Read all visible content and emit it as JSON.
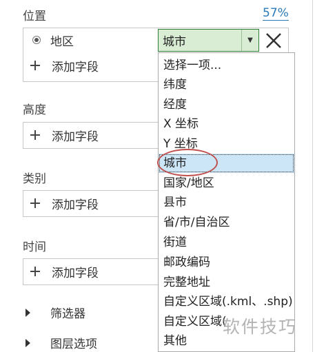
{
  "location": {
    "title": "位置",
    "percent": "57%",
    "field_label": "地区",
    "add_field": "添加字段",
    "combo_value": "城市"
  },
  "dropdown": {
    "options": [
      "选择一项...",
      "纬度",
      "经度",
      "X 坐标",
      "Y 坐标",
      "城市",
      "国家/地区",
      "县市",
      "省/市/自治区",
      "街道",
      "邮政编码",
      "完整地址",
      "自定义区域(.kml、.shp)",
      "自定义区域(",
      "其他"
    ],
    "selected_index": 5
  },
  "height": {
    "title": "高度",
    "add_field": "添加字段"
  },
  "category": {
    "title": "类别",
    "add_field": "添加字段"
  },
  "time": {
    "title": "时间",
    "add_field": "添加字段"
  },
  "tree": {
    "filters": "筛选器",
    "layer_options": "图层选项"
  },
  "watermark": "软件技巧",
  "colors": {
    "accent_link": "#2a7ab8",
    "combo_fill": "#d9ecd4",
    "combo_border": "#2e7d32",
    "selected_option": "#cde6f7",
    "annotation_circle": "#c0504d"
  },
  "icons": {
    "radio": "radio-selected-icon",
    "add": "plus-icon",
    "dropdown": "chevron-down-icon",
    "remove": "close-icon",
    "expand": "triangle-right-icon"
  }
}
